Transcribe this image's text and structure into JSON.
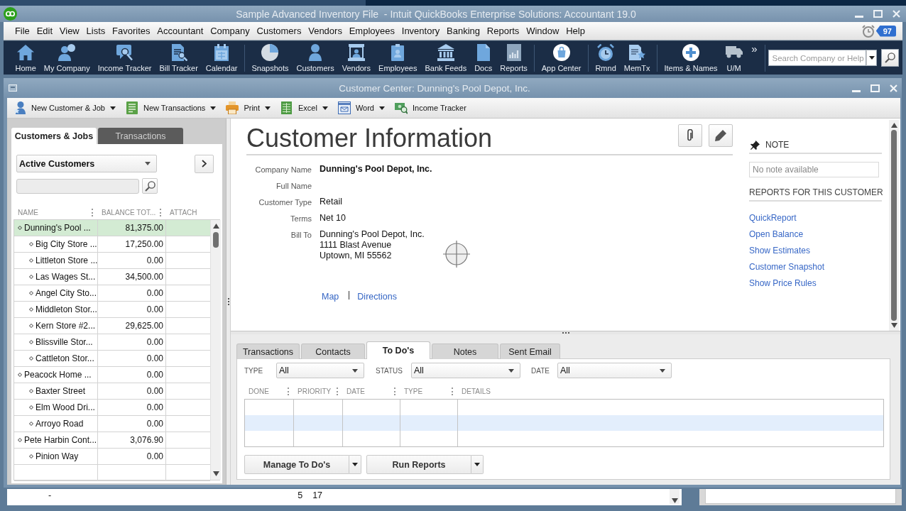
{
  "window": {
    "title": "Sample Advanced Inventory File  - Intuit QuickBooks Enterprise Solutions: Accountant 19.0"
  },
  "menu": [
    "File",
    "Edit",
    "View",
    "Lists",
    "Favorites",
    "Accountant",
    "Company",
    "Customers",
    "Vendors",
    "Employees",
    "Inventory",
    "Banking",
    "Reports",
    "Window",
    "Help"
  ],
  "alerts": {
    "count": "97"
  },
  "toolbar": {
    "groups": [
      [
        "Home",
        "My Company",
        "Income Tracker",
        "Bill Tracker",
        "Calendar"
      ],
      [
        "Snapshots",
        "Customers",
        "Vendors",
        "Employees",
        "Bank Feeds",
        "Docs",
        "Reports"
      ],
      [
        "App Center"
      ],
      [
        "Rmnd",
        "MemTx"
      ],
      [
        "Items & Names",
        "U/M"
      ]
    ],
    "more": "»",
    "search": {
      "placeholder": "Search Company or Help"
    }
  },
  "customer_center": {
    "title": "Customer Center: Dunning's Pool Depot, Inc.",
    "actions": [
      {
        "label": "New Customer & Job",
        "dropdown": true
      },
      {
        "label": "New Transactions",
        "dropdown": true
      },
      {
        "label": "Print",
        "dropdown": true
      },
      {
        "label": "Excel",
        "dropdown": true
      },
      {
        "label": "Word",
        "dropdown": true
      },
      {
        "label": "Income Tracker",
        "dropdown": false
      }
    ],
    "list_tabs": [
      {
        "label": "Customers & Jobs",
        "selected": true
      },
      {
        "label": "Transactions",
        "selected": false
      }
    ],
    "list_filter": "Active Customers",
    "list": {
      "columns": [
        "NAME",
        "BALANCE TOT...",
        "ATTACH"
      ],
      "rows": [
        {
          "name": "Dunning's Pool ...",
          "balance": "81,375.00",
          "selected": true,
          "children": [
            {
              "name": "Big City Store ...",
              "balance": "17,250.00",
              "selected": false
            },
            {
              "name": "Littleton Store ...",
              "balance": "0.00",
              "selected": false
            },
            {
              "name": "Las Wages St...",
              "balance": "34,500.00",
              "selected": false
            },
            {
              "name": "Angel City Sto...",
              "balance": "0.00",
              "selected": false
            },
            {
              "name": "Middleton Stor...",
              "balance": "0.00",
              "selected": false
            },
            {
              "name": "Kern Store #2...",
              "balance": "29,625.00",
              "selected": false
            },
            {
              "name": "Blissville Stor...",
              "balance": "0.00",
              "selected": false
            },
            {
              "name": "Cattleton Stor...",
              "balance": "0.00",
              "selected": false
            }
          ]
        },
        {
          "name": "Peacock Home ...",
          "balance": "0.00",
          "selected": false,
          "children": [
            {
              "name": "Baxter Street",
              "balance": "0.00",
              "selected": false
            },
            {
              "name": "Elm Wood Dri...",
              "balance": "0.00",
              "selected": false
            },
            {
              "name": "Arroyo Road",
              "balance": "0.00",
              "selected": false
            }
          ]
        },
        {
          "name": "Pete Harbin Cont...",
          "balance": "3,076.90",
          "selected": false,
          "children": [
            {
              "name": "Pinion Way",
              "balance": "0.00",
              "selected": false
            }
          ]
        }
      ]
    },
    "info": {
      "heading": "Customer Information",
      "fields": [
        {
          "label": "Company Name",
          "kind": "name",
          "value": "Dunning's Pool Depot, Inc."
        },
        {
          "label": "Full Name",
          "kind": "text"
        },
        {
          "label": "Customer Type",
          "kind": "text",
          "value": "Retail"
        },
        {
          "label": "Terms",
          "kind": "text",
          "value": "Net 10"
        },
        {
          "label": "Bill To",
          "kind": "address",
          "lines": [
            "Dunning's Pool Depot, Inc.",
            "1111 Blast Avenue",
            "Uptown, MI 55562"
          ]
        }
      ],
      "links": [
        "Map",
        "Directions"
      ]
    },
    "note": {
      "title": "NOTE",
      "text": "No note available"
    },
    "reports": {
      "title": "REPORTS FOR THIS CUSTOMER",
      "links": [
        "QuickReport",
        "Open Balance",
        "Show Estimates",
        "Customer Snapshot",
        "Show Price Rules"
      ]
    },
    "detail_tabs": [
      {
        "label": "Transactions",
        "selected": false
      },
      {
        "label": "Contacts",
        "selected": false
      },
      {
        "label": "To Do's",
        "selected": true
      },
      {
        "label": "Notes",
        "selected": false
      },
      {
        "label": "Sent Email",
        "selected": false
      }
    ],
    "filters": [
      {
        "label": "TYPE",
        "value": "All"
      },
      {
        "label": "STATUS",
        "value": "All"
      },
      {
        "label": "DATE",
        "value": "All"
      }
    ],
    "todo_columns": [
      "DONE",
      "PRIORITY",
      "DATE",
      "TYPE",
      "DETAILS"
    ],
    "buttons": [
      "Manage To Do's",
      "Run Reports"
    ]
  },
  "background_window": {
    "values": [
      "-",
      "5",
      "17"
    ]
  }
}
